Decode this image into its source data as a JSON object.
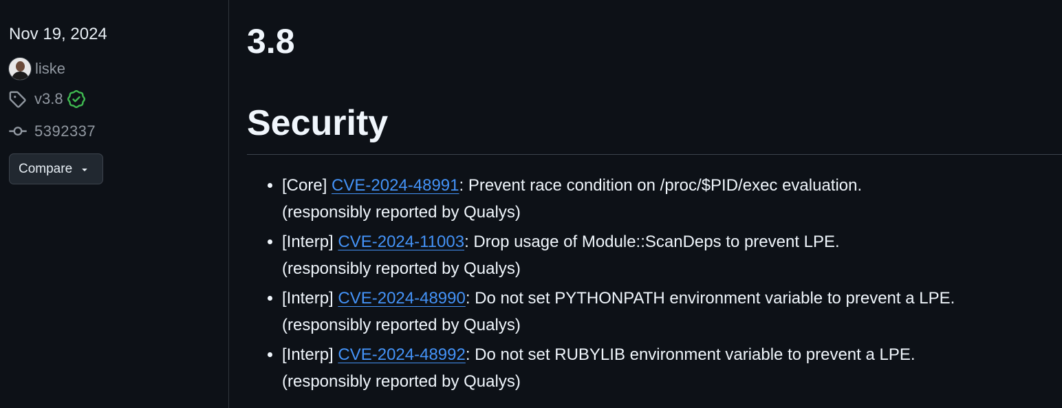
{
  "sidebar": {
    "date": "Nov 19, 2024",
    "author": "liske",
    "tag": "v3.8",
    "commit": "5392337",
    "compare_label": "Compare"
  },
  "release": {
    "title": "3.8",
    "section_heading": "Security",
    "items": [
      {
        "prefix": "[Core] ",
        "cve": "CVE-2024-48991",
        "text": ": Prevent race condition on /proc/$PID/exec evaluation.",
        "credit": "(responsibly reported by Qualys)"
      },
      {
        "prefix": "[Interp] ",
        "cve": "CVE-2024-11003",
        "text": ": Drop usage of Module::ScanDeps to prevent LPE.",
        "credit": "(responsibly reported by Qualys)"
      },
      {
        "prefix": "[Interp] ",
        "cve": "CVE-2024-48990",
        "text": ": Do not set PYTHONPATH environment variable to prevent a LPE.",
        "credit": "(responsibly reported by Qualys)"
      },
      {
        "prefix": "[Interp] ",
        "cve": "CVE-2024-48992",
        "text": ": Do not set RUBYLIB environment variable to prevent a LPE.",
        "credit": "(responsibly reported by Qualys)"
      }
    ]
  },
  "icons": {
    "avatar": "avatar",
    "tag": "tag-icon",
    "verified": "verified-check-icon",
    "commit": "git-commit-icon",
    "caret": "triangle-down-icon"
  },
  "colors": {
    "background": "#0d1117",
    "text": "#e6edf3",
    "muted": "#9198a1",
    "link": "#4493f8",
    "verified": "#3fb950",
    "border": "#30363d",
    "button_bg": "#212830"
  }
}
